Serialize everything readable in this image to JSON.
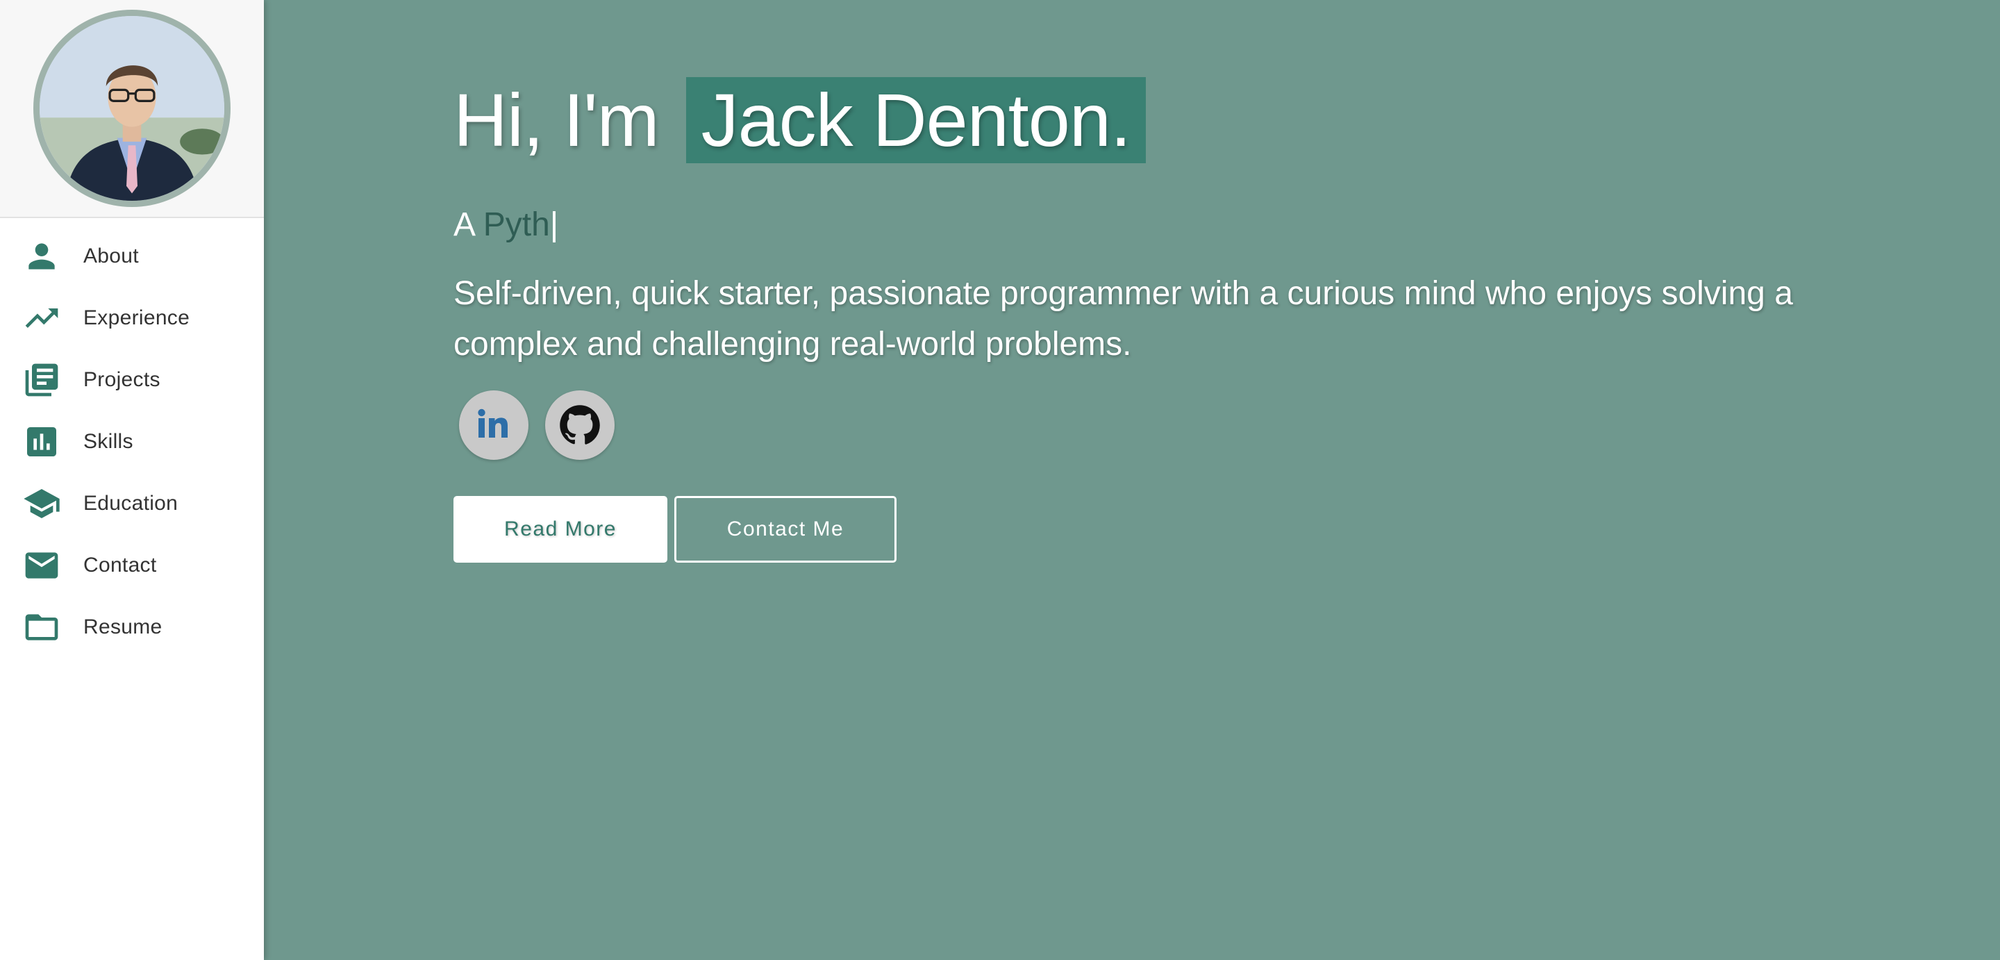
{
  "colors": {
    "accent": "#33796b",
    "main_bg": "#6f988e",
    "name_highlight": "#3a8173",
    "sidebar_bg": "#ffffff"
  },
  "sidebar": {
    "avatar_alt": "profile-photo",
    "items": [
      {
        "label": "About",
        "icon": "person-icon"
      },
      {
        "label": "Experience",
        "icon": "trending-up-icon"
      },
      {
        "label": "Projects",
        "icon": "library-books-icon"
      },
      {
        "label": "Skills",
        "icon": "bar-chart-icon"
      },
      {
        "label": "Education",
        "icon": "graduation-cap-icon"
      },
      {
        "label": "Contact",
        "icon": "mail-icon"
      },
      {
        "label": "Resume",
        "icon": "folder-icon"
      }
    ]
  },
  "hero": {
    "greeting": "Hi, I'm",
    "name": "Jack Denton.",
    "subtitle_prefix": "A",
    "subtitle_typed": "Pyth",
    "cursor": "|",
    "tagline": "Self-driven, quick starter, passionate programmer with a curious mind who enjoys solving a complex and challenging real-world problems."
  },
  "socials": [
    {
      "name": "LinkedIn",
      "icon": "linkedin-icon"
    },
    {
      "name": "GitHub",
      "icon": "github-icon"
    }
  ],
  "buttons": {
    "read_more": "Read More",
    "contact_me": "Contact Me"
  }
}
